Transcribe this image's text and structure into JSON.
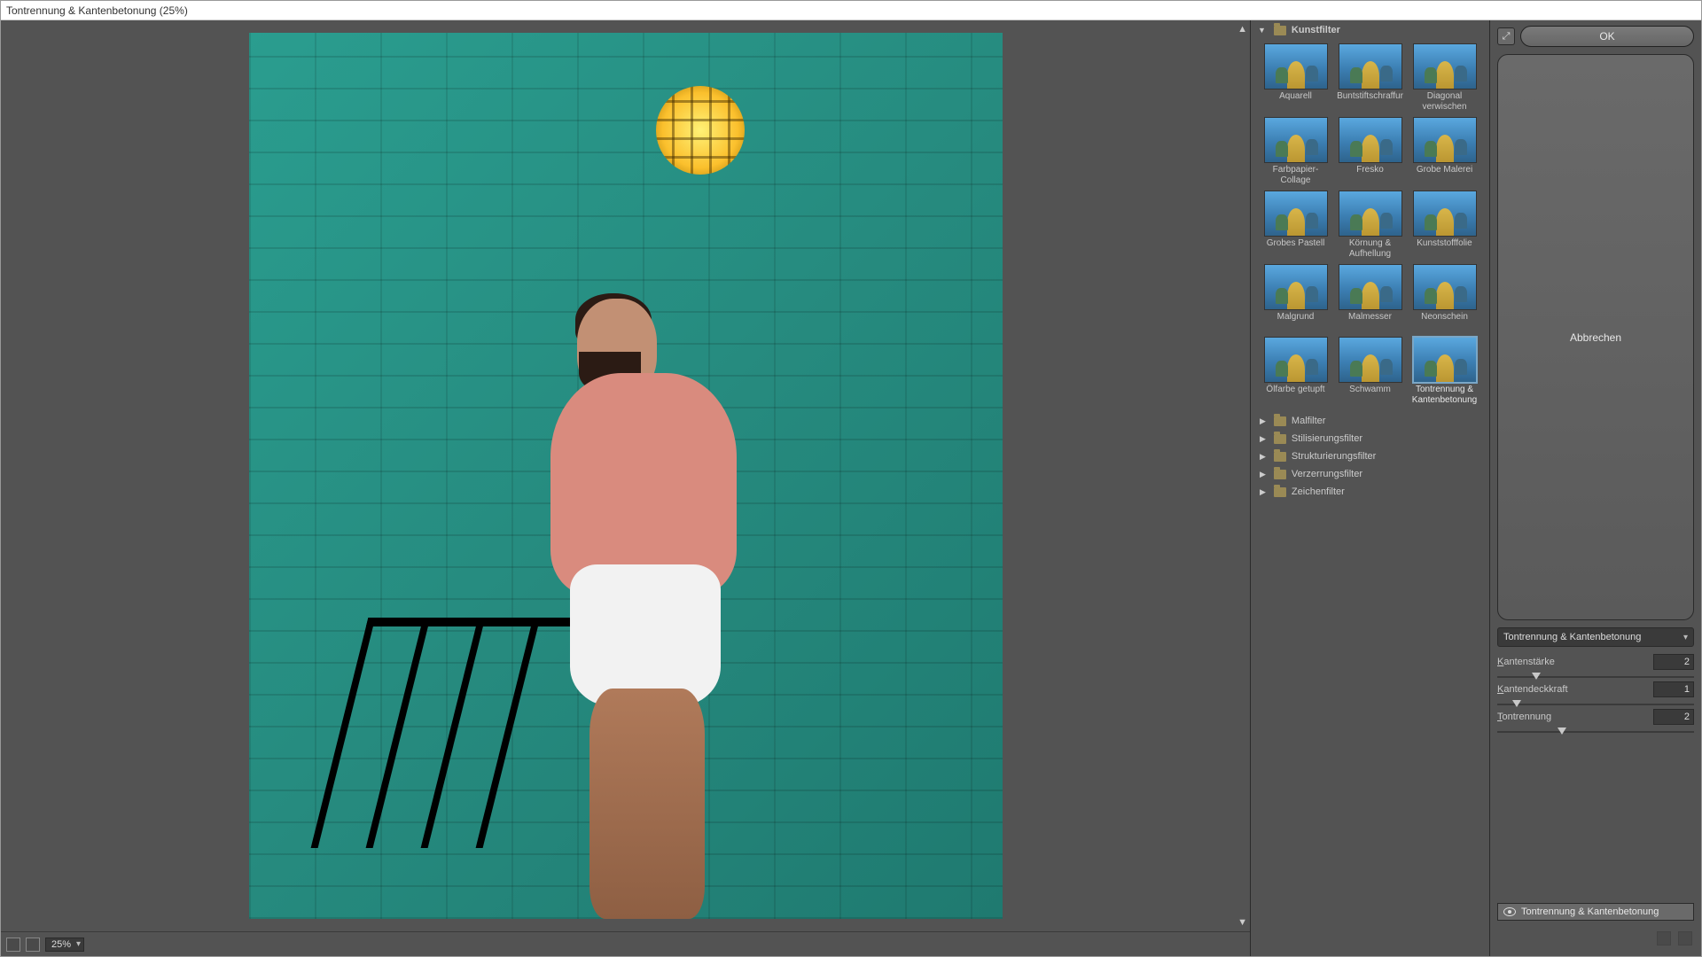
{
  "title": "Tontrennung & Kantenbetonung (25%)",
  "preview": {
    "zoom": "25%"
  },
  "filter_panel": {
    "open_category": "Kunstfilter",
    "thumbs": [
      {
        "label": "Aquarell"
      },
      {
        "label": "Buntstiftschraffur"
      },
      {
        "label": "Diagonal verwischen"
      },
      {
        "label": "Farbpapier-Collage"
      },
      {
        "label": "Fresko"
      },
      {
        "label": "Grobe Malerei"
      },
      {
        "label": "Grobes Pastell"
      },
      {
        "label": "Körnung & Aufhellung"
      },
      {
        "label": "Kunststofffolie"
      },
      {
        "label": "Malgrund"
      },
      {
        "label": "Malmesser"
      },
      {
        "label": "Neonschein"
      },
      {
        "label": "Ölfarbe getupft"
      },
      {
        "label": "Schwamm"
      },
      {
        "label": "Tontrennung & Kantenbetonung",
        "selected": true
      }
    ],
    "closed_categories": [
      "Malfilter",
      "Stilisierungsfilter",
      "Strukturierungsfilter",
      "Verzerrungsfilter",
      "Zeichenfilter"
    ]
  },
  "settings": {
    "ok_label": "OK",
    "cancel_label": "Abbrechen",
    "dropdown_value": "Tontrennung & Kantenbetonung",
    "params": [
      {
        "label": "Kantenstärke",
        "value": "2",
        "pos_pct": 20
      },
      {
        "label": "Kantendeckkraft",
        "value": "1",
        "pos_pct": 10
      },
      {
        "label": "Tontrennung",
        "value": "2",
        "pos_pct": 33
      }
    ],
    "layer_name": "Tontrennung & Kantenbetonung"
  }
}
